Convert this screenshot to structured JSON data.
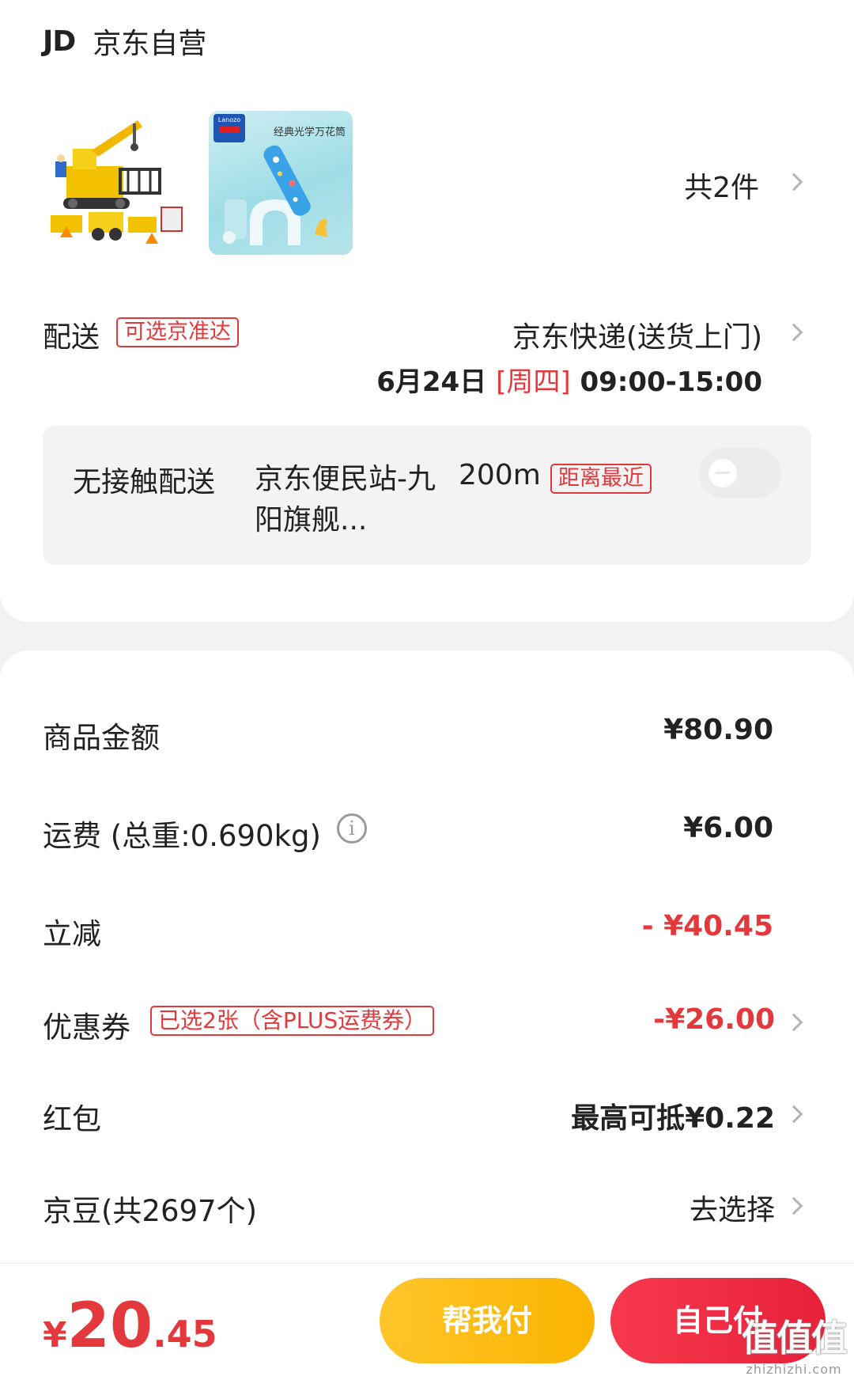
{
  "shop": {
    "logo": "JD",
    "name": "京东自营"
  },
  "products": {
    "thumb1_alt": "construction-toy-set",
    "thumb2_caption": "经典光学万花筒",
    "thumb2_brand": "Lanozo",
    "count_label": "共2件"
  },
  "delivery": {
    "label": "配送",
    "tag": "可选京准达",
    "method": "京东快递(送货上门)",
    "date": "6月24日",
    "weekday": "[周四]",
    "time": "09:00-15:00"
  },
  "contactless": {
    "label": "无接触配送",
    "station": "京东便民站-九阳旗舰...",
    "distance": "200m",
    "tag": "距离最近",
    "enabled": false
  },
  "summary": {
    "goods_label": "商品金额",
    "goods_value": "¥80.90",
    "shipping_label": "运费 (总重:0.690kg)",
    "shipping_value": "¥6.00",
    "discount_label": "立减",
    "discount_value": "- ¥40.45",
    "coupon_label": "优惠券",
    "coupon_tag": "已选2张（含PLUS运费券）",
    "coupon_value": "-¥26.00",
    "redpacket_label": "红包",
    "redpacket_value": "最高可抵¥0.22",
    "beans_label": "京豆(共2697个)",
    "beans_value": "去选择"
  },
  "bottom": {
    "currency": "¥",
    "total_int": "20",
    "total_dec": ".45",
    "help_pay": "帮我付",
    "self_pay": "自己付"
  },
  "watermark": {
    "glyphs": "值值值",
    "url": "zhizhizhi.com"
  },
  "colors": {
    "accent": "#e4393c",
    "help_btn": "#fbb400",
    "self_btn": "#e7203a"
  }
}
